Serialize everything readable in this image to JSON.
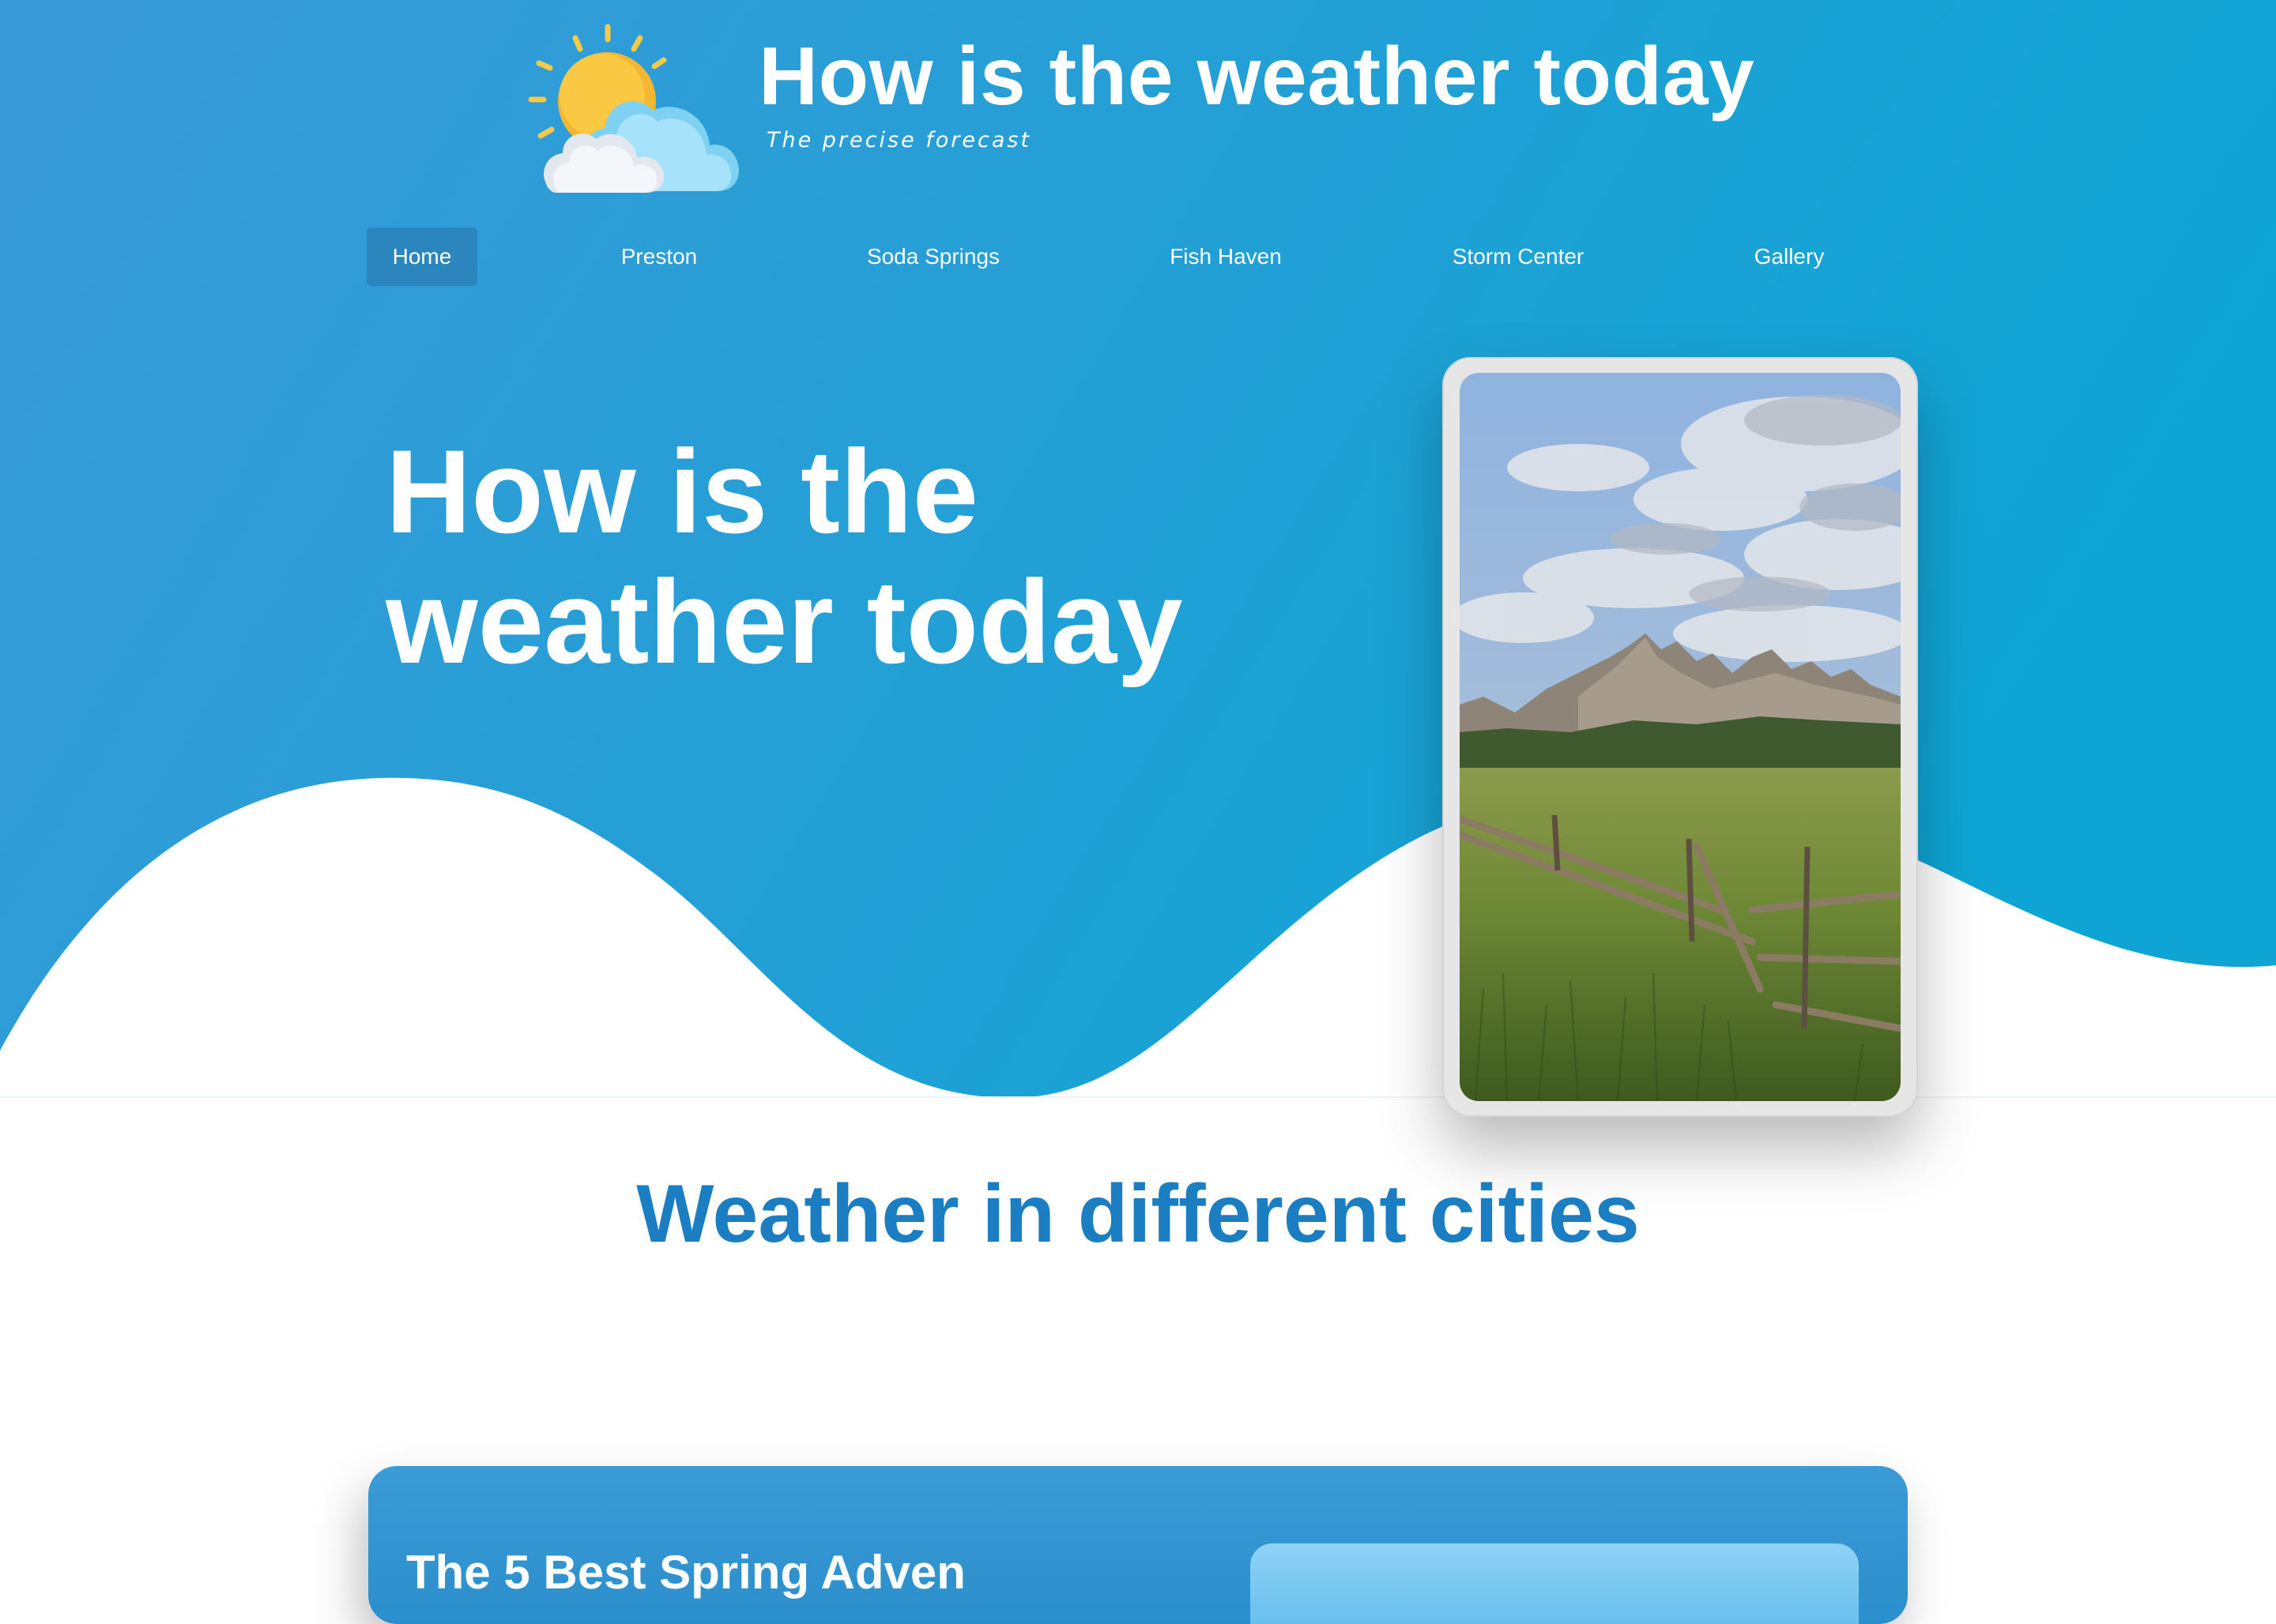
{
  "header": {
    "title": "How is the weather today",
    "tagline": "The precise forecast",
    "logo_icon": "sun-behind-cloud-icon"
  },
  "nav": {
    "items": [
      {
        "label": "Home",
        "active": true
      },
      {
        "label": "Preston",
        "active": false
      },
      {
        "label": "Soda Springs",
        "active": false
      },
      {
        "label": "Fish Haven",
        "active": false
      },
      {
        "label": "Storm Center",
        "active": false
      },
      {
        "label": "Gallery",
        "active": false
      }
    ]
  },
  "hero": {
    "line1": "How is the",
    "line2": "weather today",
    "image_subject": "mountain-meadow-photo"
  },
  "section": {
    "title": "Weather in different cities"
  },
  "card": {
    "heading": "The 5 Best Spring Adven"
  },
  "colors": {
    "hero_start": "#3a9ad8",
    "hero_end": "#0ea5d4",
    "nav_active": "#2a86bd",
    "section_title": "#1b7ec2",
    "card": "#3a9bd6"
  }
}
